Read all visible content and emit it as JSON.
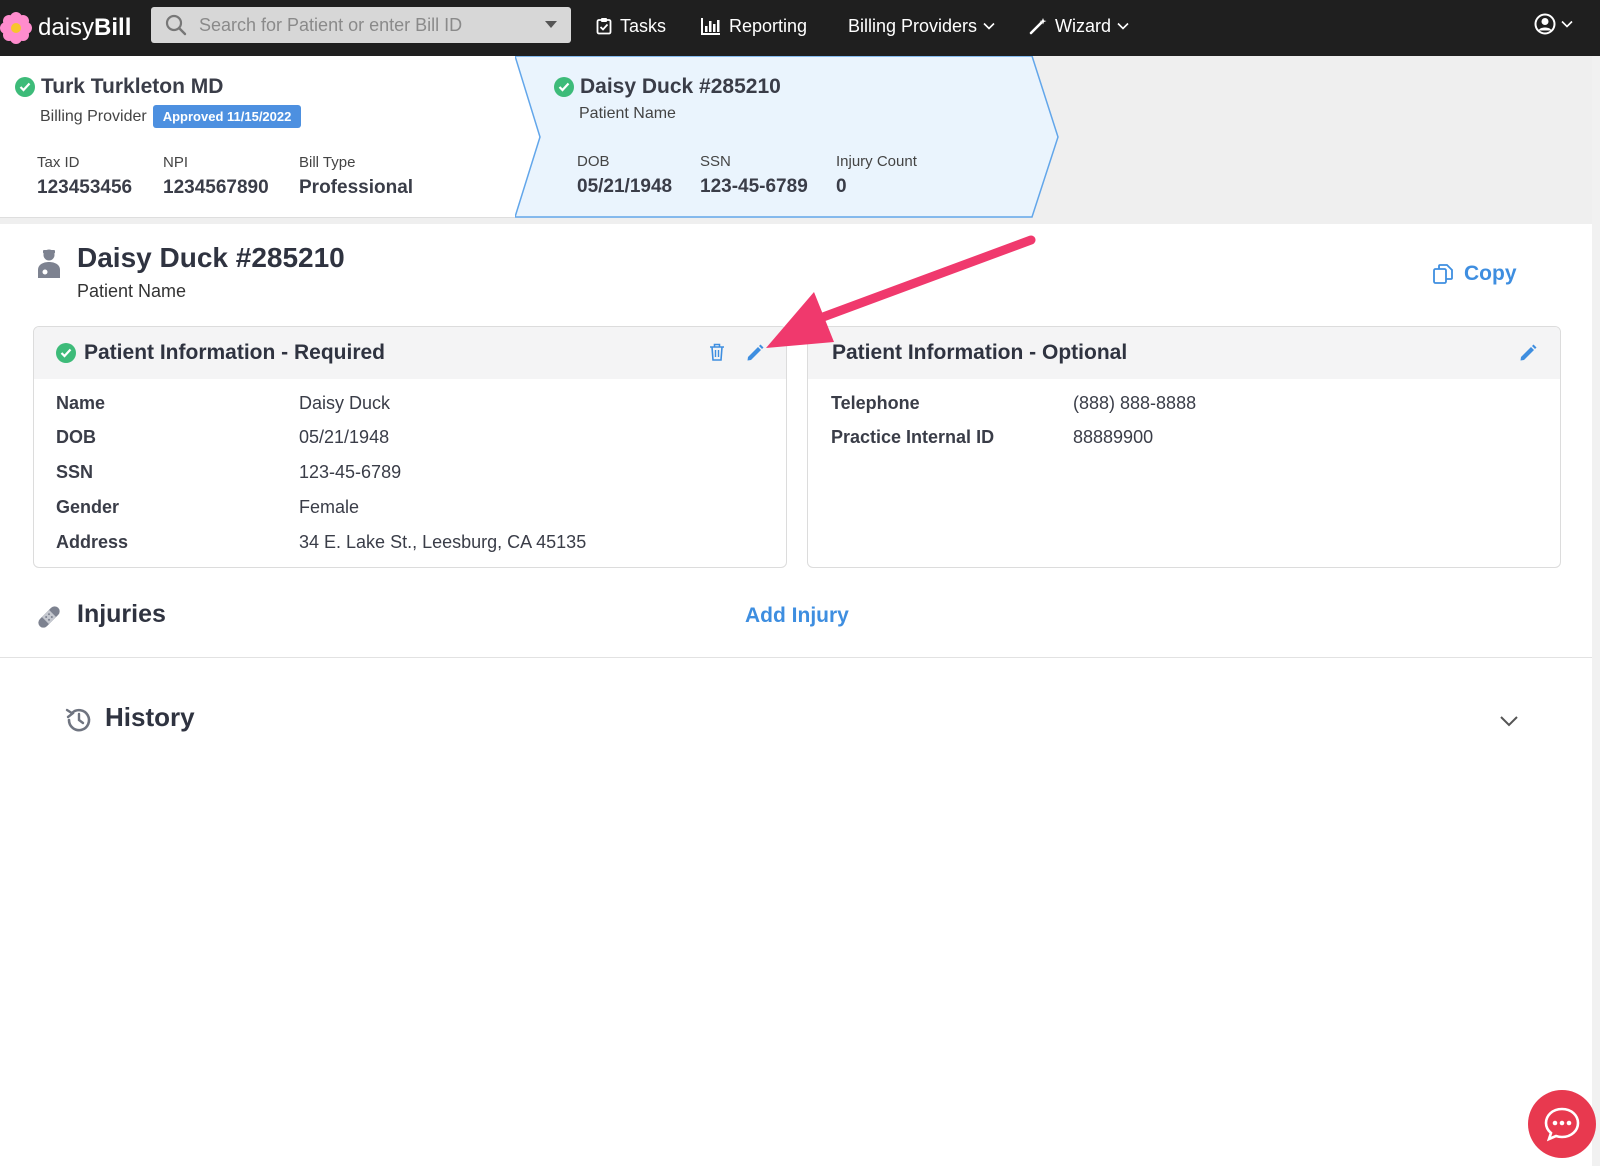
{
  "nav": {
    "brand_light": "daisy",
    "brand_bold": "Bill",
    "search_placeholder": "Search for Patient or enter Bill ID",
    "tasks": "Tasks",
    "reporting": "Reporting",
    "billing_providers": "Billing Providers",
    "wizard": "Wizard"
  },
  "provider": {
    "name": "Turk Turkleton MD",
    "role": "Billing Provider",
    "badge": "Approved 11/15/2022",
    "fields": [
      {
        "label": "Tax ID",
        "value": "123453456"
      },
      {
        "label": "NPI",
        "value": "1234567890"
      },
      {
        "label": "Bill Type",
        "value": "Professional"
      }
    ]
  },
  "patient_crumb": {
    "name": "Daisy Duck #285210",
    "role": "Patient Name",
    "fields": [
      {
        "label": "DOB",
        "value": "05/21/1948"
      },
      {
        "label": "SSN",
        "value": "123-45-6789"
      },
      {
        "label": "Injury Count",
        "value": "0"
      }
    ]
  },
  "patient": {
    "title": "Daisy Duck #285210",
    "subtitle": "Patient Name",
    "copy_label": "Copy"
  },
  "required_card": {
    "title": "Patient Information - Required",
    "rows": [
      {
        "label": "Name",
        "value": "Daisy Duck"
      },
      {
        "label": "DOB",
        "value": "05/21/1948"
      },
      {
        "label": "SSN",
        "value": "123-45-6789"
      },
      {
        "label": "Gender",
        "value": "Female"
      },
      {
        "label": "Address",
        "value": "34 E. Lake St., Leesburg, CA 45135"
      }
    ]
  },
  "optional_card": {
    "title": "Patient Information - Optional",
    "rows": [
      {
        "label": "Telephone",
        "value": "(888) 888-8888"
      },
      {
        "label": "Practice Internal ID",
        "value": "88889900"
      }
    ]
  },
  "injuries": {
    "title": "Injuries",
    "add_label": "Add Injury"
  },
  "history": {
    "title": "History"
  },
  "colors": {
    "accent": "#3e8ee0",
    "success": "#3dbb79",
    "arrow": "#f0396d",
    "chat": "#e8394f"
  }
}
